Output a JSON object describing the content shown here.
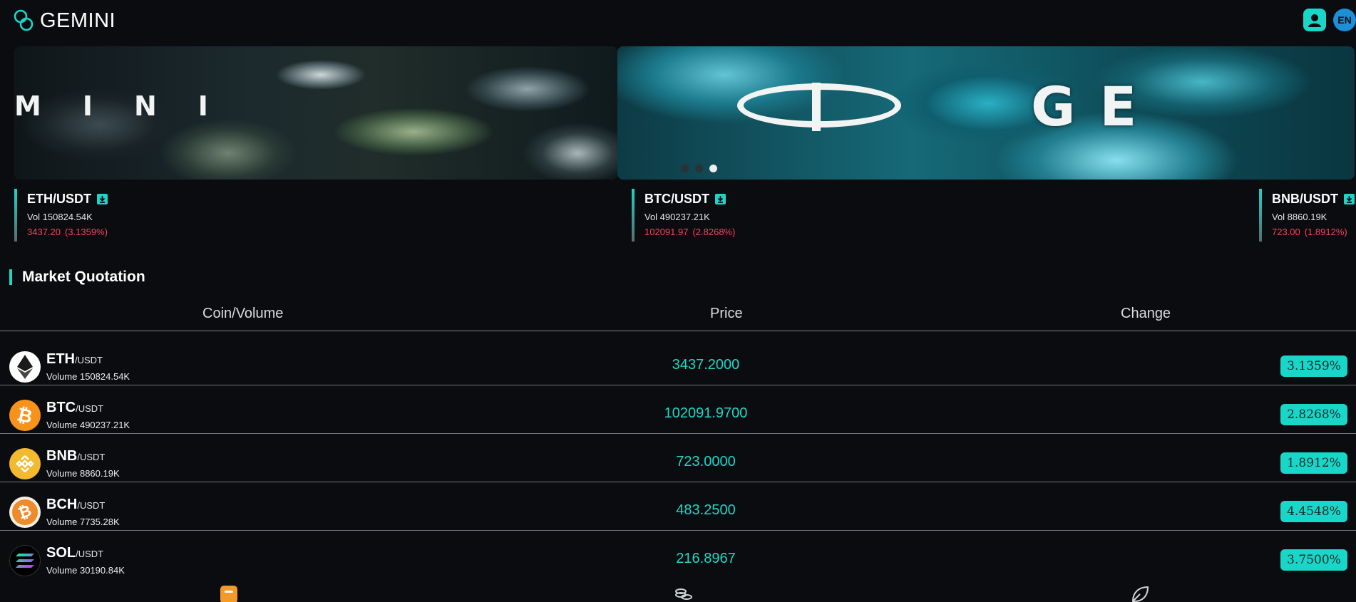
{
  "header": {
    "brand": "GEMINI",
    "user_icon": "user-icon",
    "lang_label": "EN"
  },
  "banner": {
    "slide_a_word": "MINI",
    "slide_b_word": "GE",
    "dots": 3,
    "active_dot": 2
  },
  "tickers": [
    {
      "symbol": "ETH/USDT",
      "volume": "Vol 150824.54K",
      "price": "3437.20",
      "change": "(3.1359%)"
    },
    {
      "symbol": "BTC/USDT",
      "volume": "Vol 490237.21K",
      "price": "102091.97",
      "change": "(2.8268%)"
    },
    {
      "symbol": "BNB/USDT",
      "volume": "Vol 8860.19K",
      "price": "723.00",
      "change": "(1.8912%)"
    }
  ],
  "market": {
    "title": "Market Quotation",
    "columns": {
      "coin": "Coin/Volume",
      "price": "Price",
      "change": "Change"
    },
    "rows": [
      {
        "coin": "ETH",
        "pair": "/USDT",
        "volume": "Volume 150824.54K",
        "price": "3437.2000",
        "change": "3.1359%"
      },
      {
        "coin": "BTC",
        "pair": "/USDT",
        "volume": "Volume 490237.21K",
        "price": "102091.9700",
        "change": "2.8268%"
      },
      {
        "coin": "BNB",
        "pair": "/USDT",
        "volume": "Volume 8860.19K",
        "price": "723.0000",
        "change": "1.8912%"
      },
      {
        "coin": "BCH",
        "pair": "/USDT",
        "volume": "Volume 7735.28K",
        "price": "483.2500",
        "change": "4.4548%"
      },
      {
        "coin": "SOL",
        "pair": "/USDT",
        "volume": "Volume 30190.84K",
        "price": "216.8967",
        "change": "3.7500%"
      }
    ]
  },
  "colors": {
    "accent": "#1ad6c8",
    "negative": "#f2455d",
    "background": "#0b0c10"
  },
  "bottom_nav": [
    "store-icon",
    "coins-icon",
    "leaf-icon"
  ]
}
